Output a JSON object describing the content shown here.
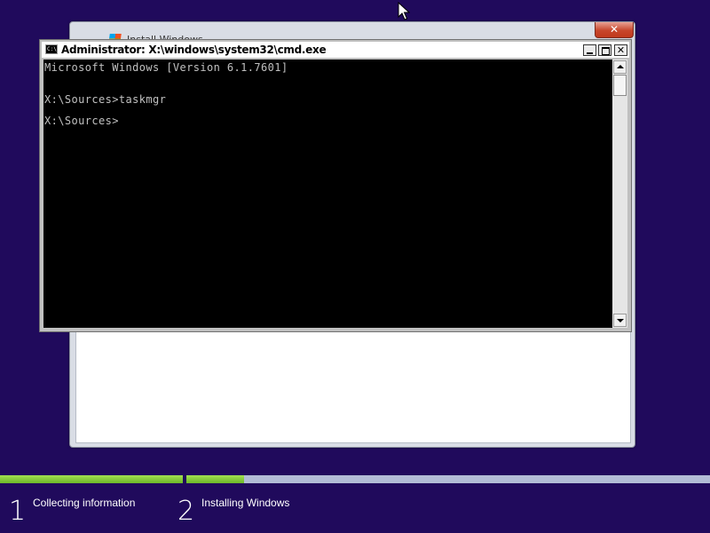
{
  "install_window": {
    "title": "Install Windows",
    "close_label": "✕"
  },
  "cmd_window": {
    "icon_text": "C:\\",
    "title": "Administrator: X:\\windows\\system32\\cmd.exe",
    "minimize_label": "",
    "maximize_label": "",
    "close_label": "✕",
    "console_lines": [
      "Microsoft Windows [Version 6.1.7601]",
      "X:\\Sources>taskmgr",
      "X:\\Sources>"
    ]
  },
  "setup_progress": {
    "steps": [
      {
        "number": "1",
        "label": "Collecting information",
        "progress": 1.0
      },
      {
        "number": "2",
        "label": "Installing Windows",
        "progress": 0.11
      }
    ]
  },
  "icons": {
    "cursor": "mouse-pointer-icon",
    "windows_flag": "windows-flag-icon",
    "cmd": "cmd-icon"
  },
  "colors": {
    "desktop_background": "#200a5c",
    "progress_fill": "#6cb82a",
    "progress_track": "#b2bcd6",
    "console_background": "#000000",
    "console_text": "#c0c0c0"
  }
}
